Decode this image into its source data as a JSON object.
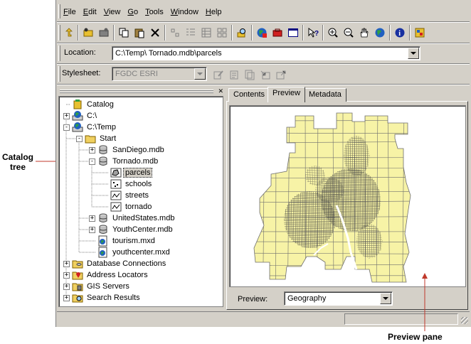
{
  "menu": [
    "File",
    "Edit",
    "View",
    "Go",
    "Tools",
    "Window",
    "Help"
  ],
  "menu_underline": [
    "F",
    "E",
    "V",
    "G",
    "T",
    "W",
    "H"
  ],
  "location": {
    "label": "Location:",
    "value": "C:\\Temp\\ Tornado.mdb\\parcels"
  },
  "stylesheet": {
    "label": "Stylesheet:",
    "value": "FGDC ESRI"
  },
  "tabs": [
    "Contents",
    "Preview",
    "Metadata"
  ],
  "tree": [
    {
      "label": "Catalog",
      "icon": "catalog-icon",
      "indent": 0,
      "pm": ""
    },
    {
      "label": "C:\\",
      "icon": "drive-icon",
      "indent": 0,
      "pm": "+"
    },
    {
      "label": "C:\\Temp",
      "icon": "drive-icon",
      "indent": 0,
      "pm": "-"
    },
    {
      "label": "Start",
      "icon": "folder-icon",
      "indent": 1,
      "pm": "-"
    },
    {
      "label": "SanDiego.mdb",
      "icon": "database-icon",
      "indent": 2,
      "pm": "+"
    },
    {
      "label": "Tornado.mdb",
      "icon": "database-icon",
      "indent": 2,
      "pm": "-"
    },
    {
      "label": "parcels",
      "icon": "polygon-featureclass-icon",
      "indent": 3,
      "pm": "",
      "selected": true
    },
    {
      "label": "schools",
      "icon": "point-featureclass-icon",
      "indent": 3,
      "pm": ""
    },
    {
      "label": "streets",
      "icon": "line-featureclass-icon",
      "indent": 3,
      "pm": ""
    },
    {
      "label": "tornado",
      "icon": "line-featureclass-icon",
      "indent": 3,
      "pm": ""
    },
    {
      "label": "UnitedStates.mdb",
      "icon": "database-icon",
      "indent": 2,
      "pm": "+"
    },
    {
      "label": "YouthCenter.mdb",
      "icon": "database-icon",
      "indent": 2,
      "pm": "+"
    },
    {
      "label": "tourism.mxd",
      "icon": "map-document-icon",
      "indent": 2,
      "pm": ""
    },
    {
      "label": "youthcenter.mxd",
      "icon": "map-document-icon",
      "indent": 2,
      "pm": ""
    },
    {
      "label": "Database Connections",
      "icon": "database-connections-icon",
      "indent": 0,
      "pm": "+"
    },
    {
      "label": "Address Locators",
      "icon": "address-locator-icon",
      "indent": 0,
      "pm": "+"
    },
    {
      "label": "GIS Servers",
      "icon": "gis-server-icon",
      "indent": 0,
      "pm": "+"
    },
    {
      "label": "Search Results",
      "icon": "search-results-icon",
      "indent": 0,
      "pm": "+"
    }
  ],
  "preview": {
    "label": "Preview:",
    "value": "Geography"
  },
  "annotations": {
    "catalog_tree_line1": "Catalog",
    "catalog_tree_line2": "tree",
    "preview_pane": "Preview pane"
  },
  "colors": {
    "parcel_fill": "#f7f3a6",
    "parcel_stroke": "#6e6e6e",
    "window_face": "#d4d0c8"
  }
}
